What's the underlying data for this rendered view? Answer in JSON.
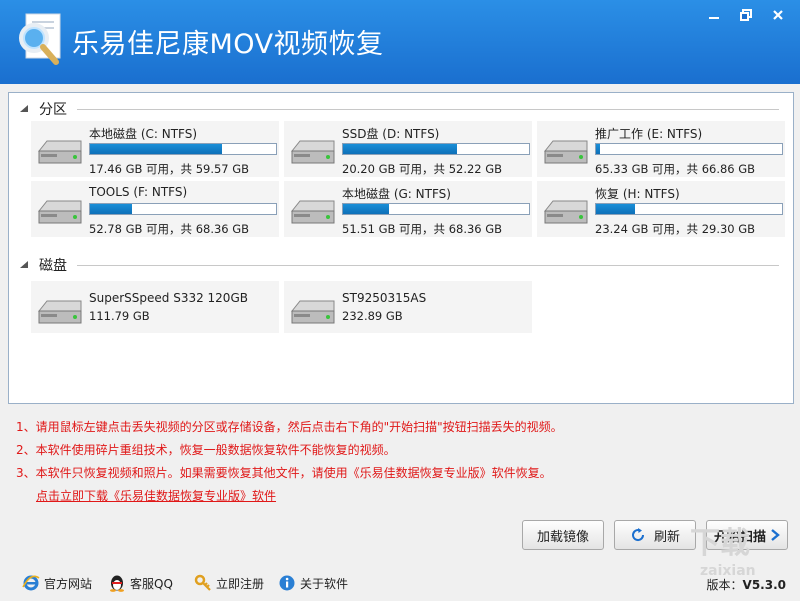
{
  "app": {
    "title": "乐易佳尼康MOV视频恢复"
  },
  "sections": {
    "partitions": "分区",
    "disks": "磁盘"
  },
  "partitions": [
    {
      "name": "本地磁盘 (C: NTFS)",
      "info": "17.46 GB 可用，共 59.57 GB",
      "used": 0.707
    },
    {
      "name": "SSD盘 (D: NTFS)",
      "info": "20.20 GB 可用，共 52.22 GB",
      "used": 0.613
    },
    {
      "name": "推广工作 (E: NTFS)",
      "info": "65.33 GB 可用，共 66.86 GB",
      "used": 0.023
    },
    {
      "name": "TOOLS (F: NTFS)",
      "info": "52.78 GB 可用，共 68.36 GB",
      "used": 0.228
    },
    {
      "name": "本地磁盘 (G: NTFS)",
      "info": "51.51 GB 可用，共 68.36 GB",
      "used": 0.246
    },
    {
      "name": "恢复 (H: NTFS)",
      "info": "23.24 GB 可用，共 29.30 GB",
      "used": 0.207
    }
  ],
  "disks": [
    {
      "name": "SuperSSpeed S332 120GB",
      "info": "111.79 GB"
    },
    {
      "name": "ST9250315AS",
      "info": "232.89 GB"
    }
  ],
  "notes": [
    "1、请用鼠标左键点击丢失视频的分区或存储设备，然后点击右下角的\"开始扫描\"按钮扫描丢失的视频。",
    "2、本软件使用碎片重组技术，恢复一般数据恢复软件不能恢复的视频。",
    "3、本软件只恢复视频和照片。如果需要恢复其他文件，请使用《乐易佳数据恢复专业版》软件恢复。"
  ],
  "download_link": "点击立即下载《乐易佳数据恢复专业版》软件",
  "buttons": {
    "load_image": "加载镜像",
    "refresh": "刷新",
    "start_scan": "开始扫描"
  },
  "statusbar": {
    "website": "官方网站",
    "qq": "客服QQ",
    "register": "立即注册",
    "about": "关于软件",
    "version_label": "版本：",
    "version": "V5.3.0"
  },
  "colors": {
    "titlebar": "#1a6fcf",
    "progress": "#0d6fb8",
    "notes": "#e01818"
  }
}
